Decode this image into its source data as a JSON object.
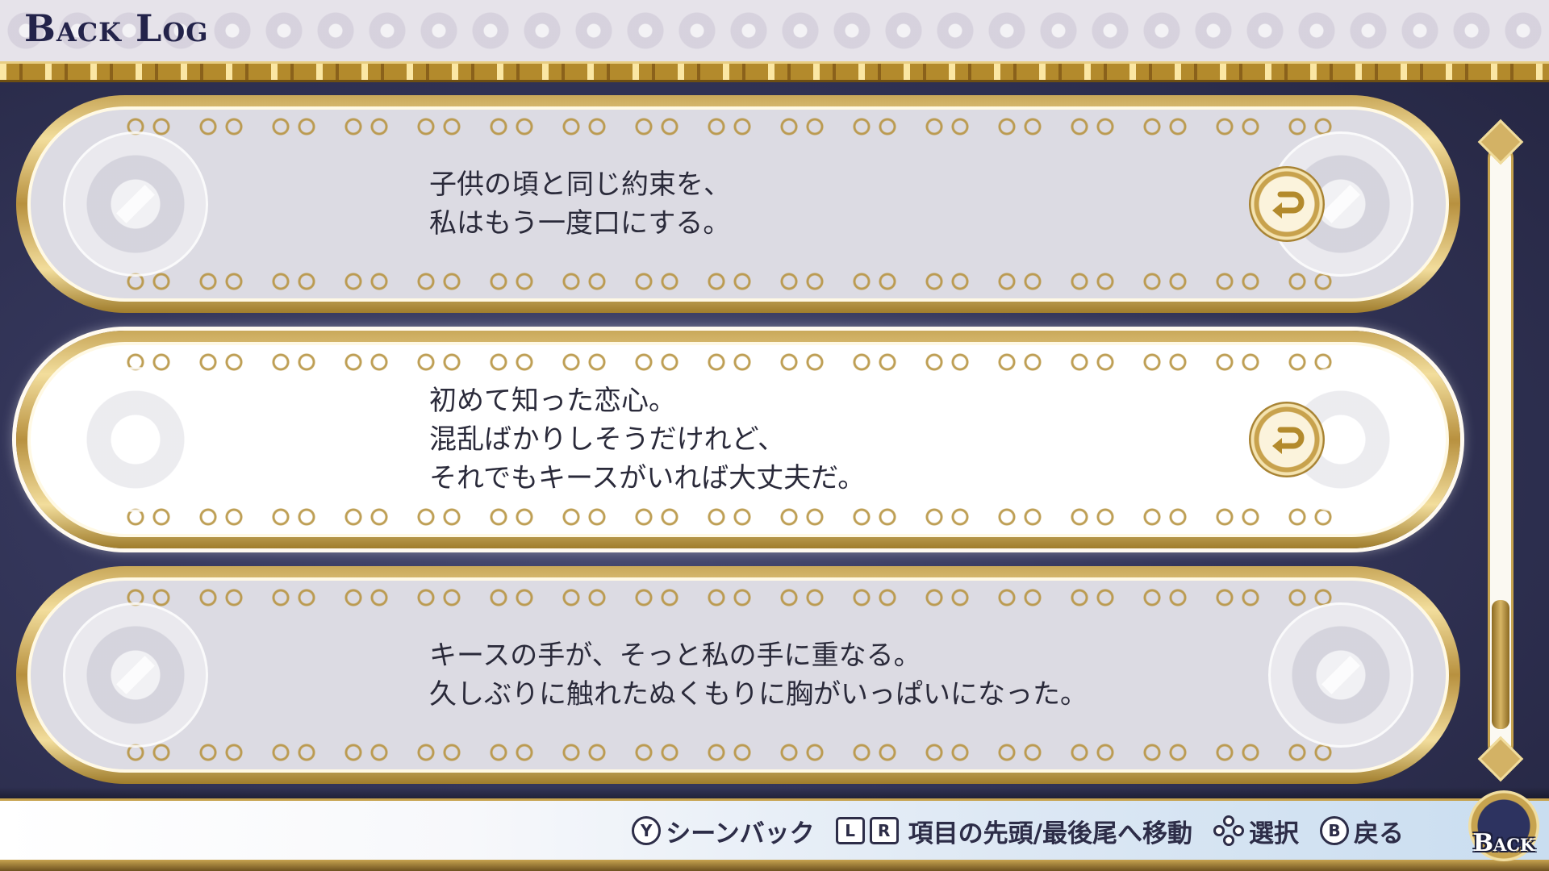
{
  "header": {
    "title": "Back Log"
  },
  "entries": [
    {
      "lines": [
        "子供の頃と同じ約束を、",
        "私はもう一度口にする。"
      ],
      "has_replay": true,
      "selected": false
    },
    {
      "lines": [
        "初めて知った恋心。",
        "混乱ばかりしそうだけれど、",
        "それでもキースがいれば大丈夫だ。"
      ],
      "has_replay": true,
      "selected": true
    },
    {
      "lines": [
        "キースの手が、そっと私の手に重なる。",
        "久しぶりに触れたぬくもりに胸がいっぱいになった。"
      ],
      "has_replay": false,
      "selected": false
    }
  ],
  "scrollbar": {
    "position_fraction": 0.95
  },
  "footer": {
    "hints": {
      "scene_back": {
        "key": "Y",
        "label": "シーンバック"
      },
      "jump": {
        "key_left": "L",
        "key_right": "R",
        "label": "項目の先頭/最後尾へ移動"
      },
      "select": {
        "icon": "dpad-icon",
        "label": "選択"
      },
      "back": {
        "key": "B",
        "label": "戻る"
      }
    },
    "back_button_label": "Back"
  },
  "colors": {
    "gold": "#c7a34f",
    "navy_text": "#2d2d48",
    "background": "#34365a",
    "entry_bg": "#dcdbe3",
    "entry_selected_bg": "#ffffff"
  },
  "icons": {
    "replay": "replay-arrow-icon",
    "ornament": "compass-ornament-icon"
  }
}
